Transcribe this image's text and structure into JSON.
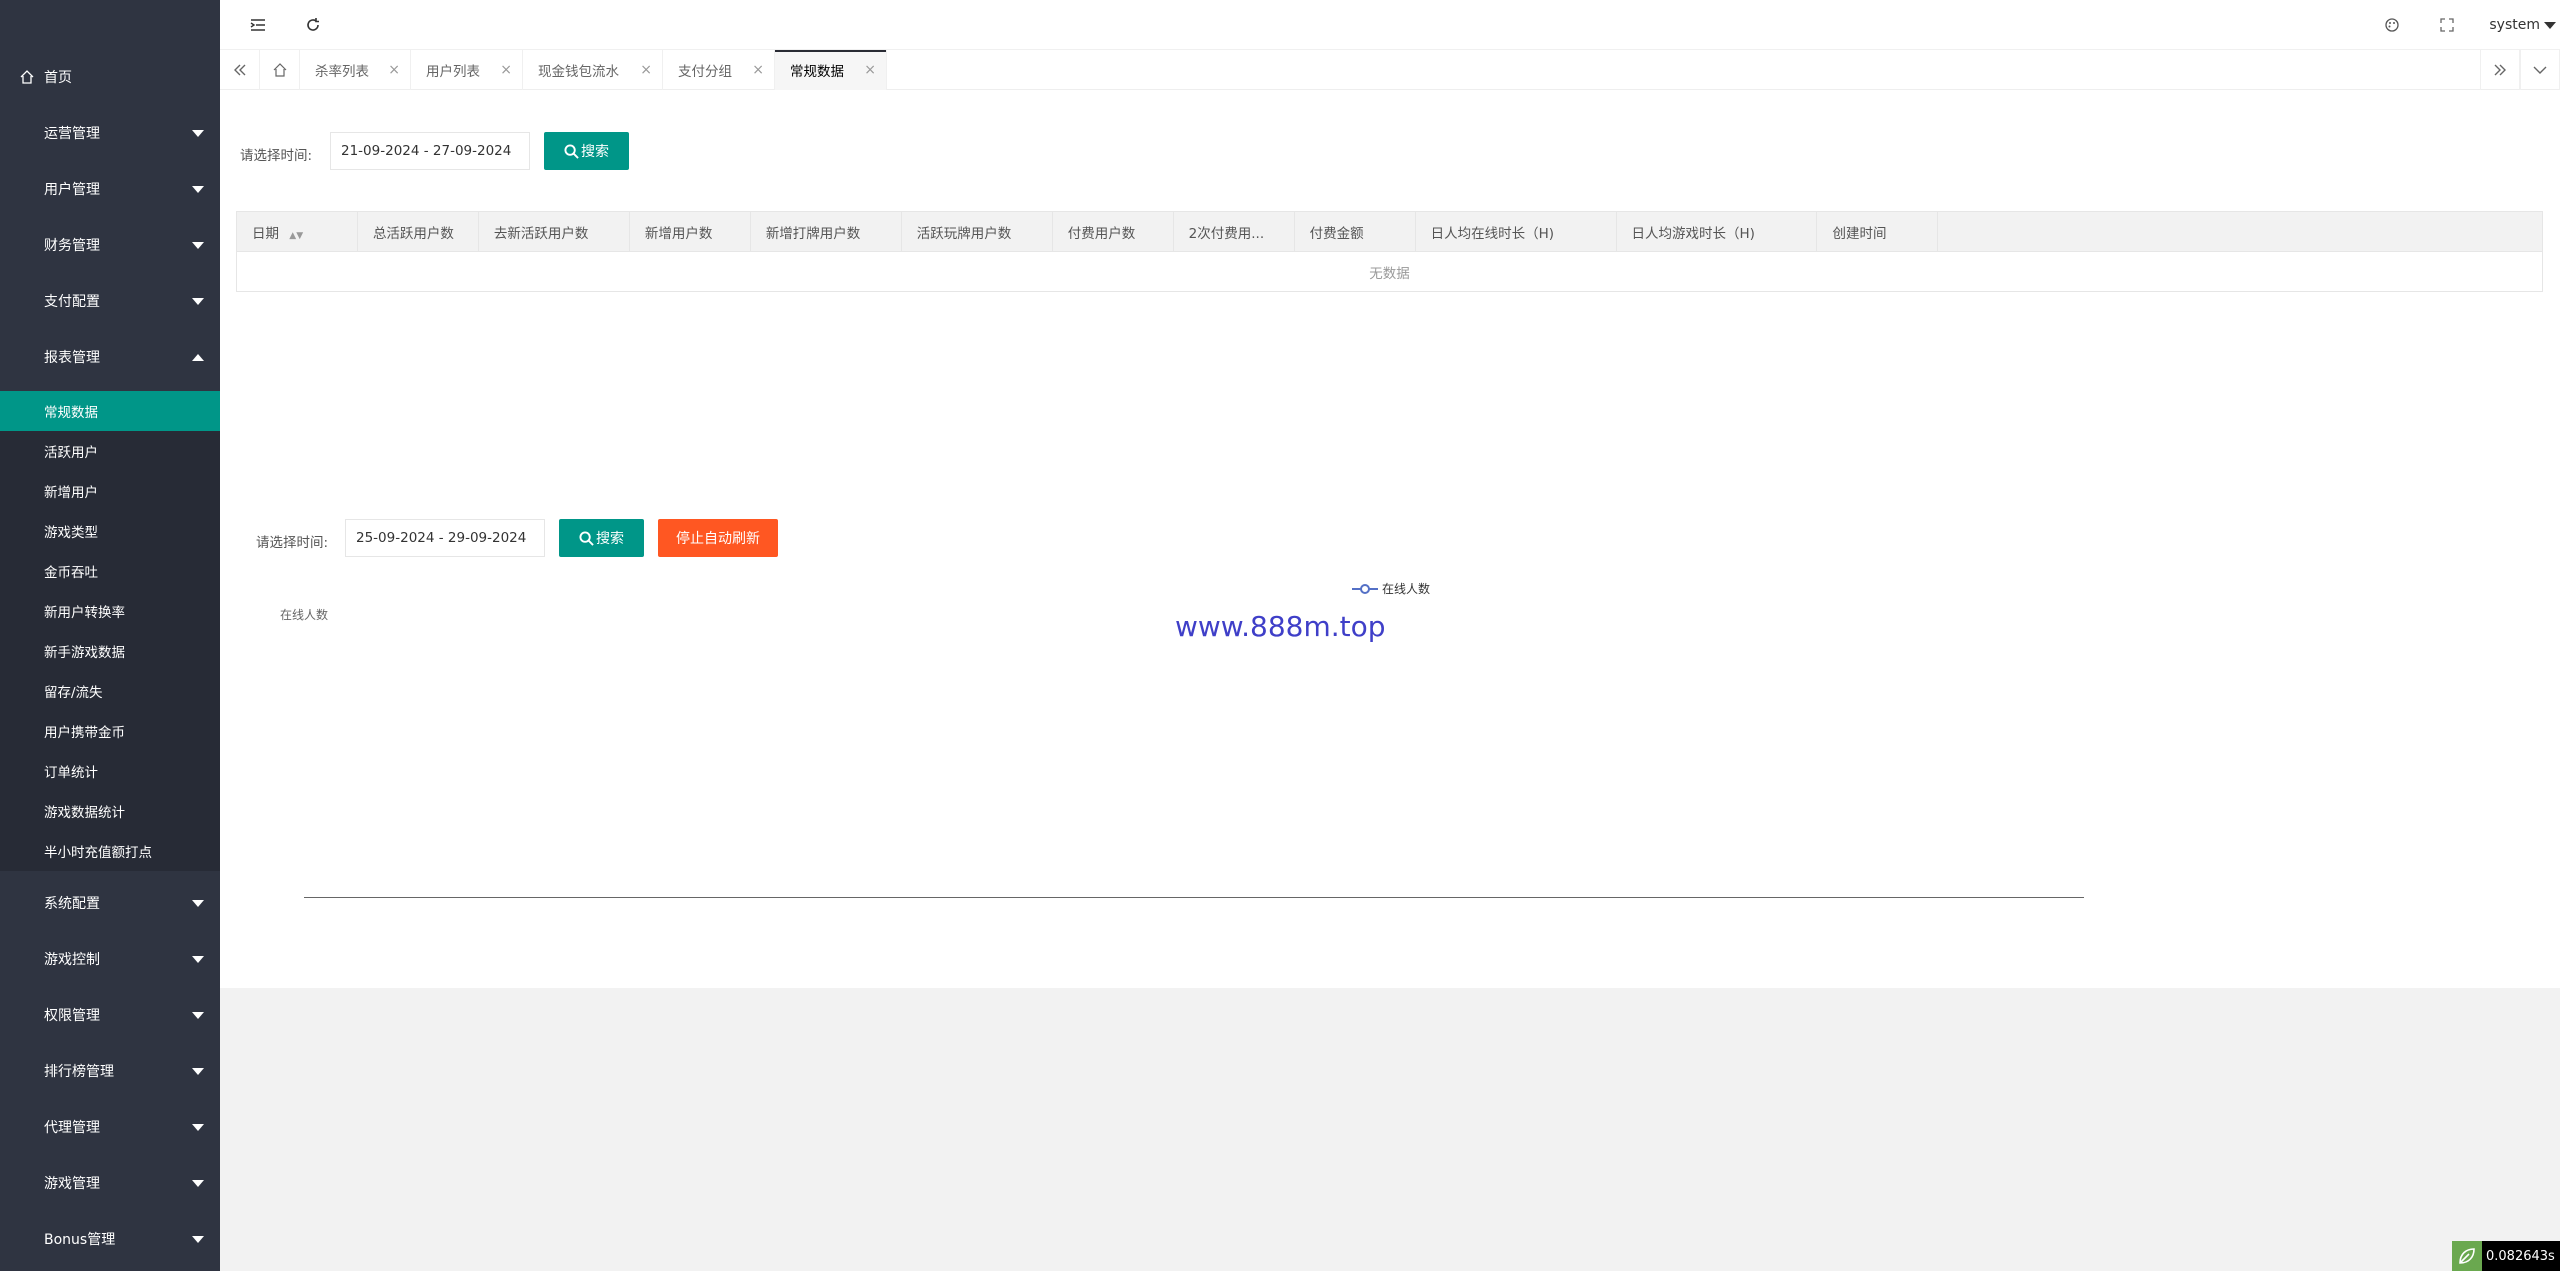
{
  "sidebar": {
    "home": "首页",
    "groups_top": [
      "运营管理",
      "用户管理",
      "财务管理",
      "支付配置"
    ],
    "reports": {
      "label": "报表管理",
      "items": [
        "常规数据",
        "活跃用户",
        "新增用户",
        "游戏类型",
        "金币吞吐",
        "新用户转换率",
        "新手游戏数据",
        "留存/流失",
        "用户携带金币",
        "订单统计",
        "游戏数据统计",
        "半小时充值额打点"
      ],
      "active": "常规数据"
    },
    "groups_bottom": [
      "系统配置",
      "游戏控制",
      "权限管理",
      "排行榜管理",
      "代理管理",
      "游戏管理",
      "Bonus管理"
    ]
  },
  "topbar": {
    "user": "system"
  },
  "tabs": [
    "杀率列表",
    "用户列表",
    "现金钱包流水",
    "支付分组",
    "常规数据"
  ],
  "filter1": {
    "label": "请选择时间:",
    "date_range": "21-09-2024 - 27-09-2024",
    "search": "搜索"
  },
  "table": {
    "columns": [
      "日期",
      "总活跃用户数",
      "去新活跃用户数",
      "新增用户数",
      "新增打牌用户数",
      "活跃玩牌用户数",
      "付费用户数",
      "2次付费用...",
      "付费金额",
      "日人均在线时长（H)",
      "日人均游戏时长（H)",
      "创建时间"
    ],
    "empty": "无数据"
  },
  "filter2": {
    "label": "请选择时间:",
    "date_range": "25-09-2024 - 29-09-2024",
    "search": "搜索",
    "stop_refresh": "停止自动刷新"
  },
  "chart": {
    "legend": "在线人数",
    "axis_name": "在线人数",
    "watermark": "www.888m.top"
  },
  "timer": "0.082643s",
  "colors": {
    "accent": "#009688",
    "orange": "#ff5722",
    "sidebar": "#2f3441"
  }
}
